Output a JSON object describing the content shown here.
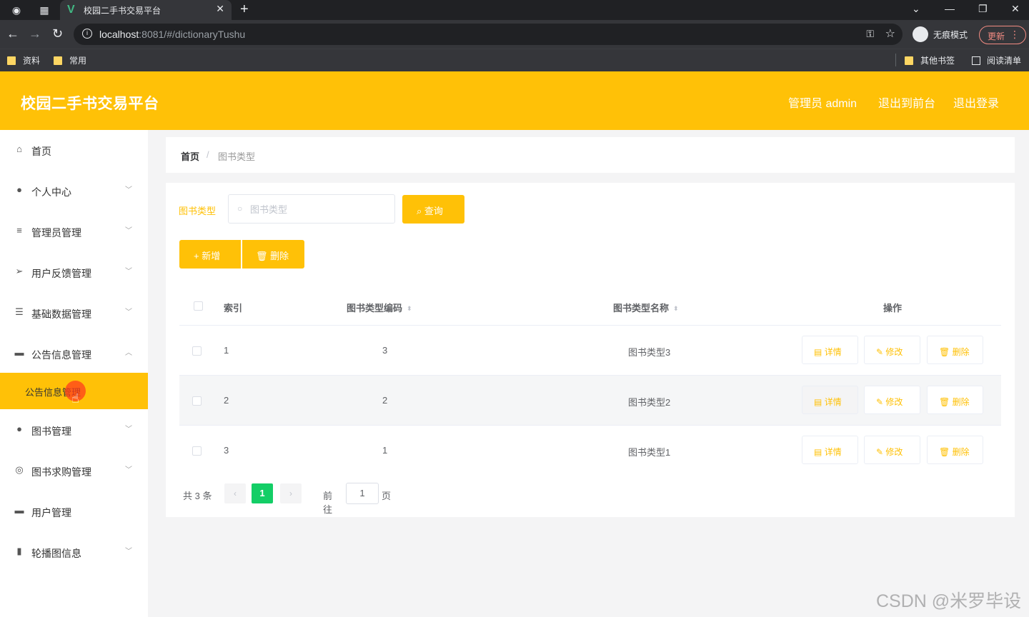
{
  "browser": {
    "tab_title": "校园二手书交易平台",
    "url_host": "localhost",
    "url_rest": ":8081/#/dictionaryTushu",
    "incognito_label": "无痕模式",
    "update_label": "更新",
    "bookmarks": [
      "资料",
      "常用"
    ],
    "bookmarks_right": [
      "其他书签",
      "阅读清单"
    ]
  },
  "header": {
    "title": "校园二手书交易平台",
    "user_label": "管理员 admin",
    "front_link": "退出到前台",
    "logout_link": "退出登录"
  },
  "sidebar": {
    "items": [
      {
        "label": "首页",
        "icon": "home-icon"
      },
      {
        "label": "个人中心",
        "icon": "user-icon"
      },
      {
        "label": "管理员管理",
        "icon": "menu-icon"
      },
      {
        "label": "用户反馈管理",
        "icon": "send-icon"
      },
      {
        "label": "基础数据管理",
        "icon": "sliders-icon"
      },
      {
        "label": "公告信息管理",
        "icon": "monitor-icon"
      },
      {
        "label": "图书管理",
        "icon": "user-icon"
      },
      {
        "label": "图书求购管理",
        "icon": "circle-icon"
      },
      {
        "label": "用户管理",
        "icon": "monitor-icon"
      },
      {
        "label": "轮播图信息",
        "icon": "chart-icon"
      }
    ],
    "active_sub": "公告信息管理"
  },
  "breadcrumb": {
    "home": "首页",
    "sep": "/",
    "current": "图书类型"
  },
  "search": {
    "label": "图书类型",
    "placeholder": "图书类型",
    "query_button": "查询"
  },
  "actions": {
    "add": "新增",
    "delete": "删除"
  },
  "table": {
    "headers": {
      "index": "索引",
      "code": "图书类型编码",
      "name": "图书类型名称",
      "ops": "操作"
    },
    "rows": [
      {
        "index": "1",
        "code": "3",
        "name": "图书类型3"
      },
      {
        "index": "2",
        "code": "2",
        "name": "图书类型2"
      },
      {
        "index": "3",
        "code": "1",
        "name": "图书类型1"
      }
    ],
    "op_labels": {
      "detail": "详情",
      "edit": "修改",
      "delete": "删除"
    }
  },
  "pagination": {
    "total": "共 3 条",
    "current": "1",
    "goto": "前往",
    "page_input": "1",
    "page_suffix": "页"
  },
  "watermark": "CSDN @米罗毕设",
  "colors": {
    "accent": "#ffc107",
    "pager_active": "#13ce66"
  }
}
